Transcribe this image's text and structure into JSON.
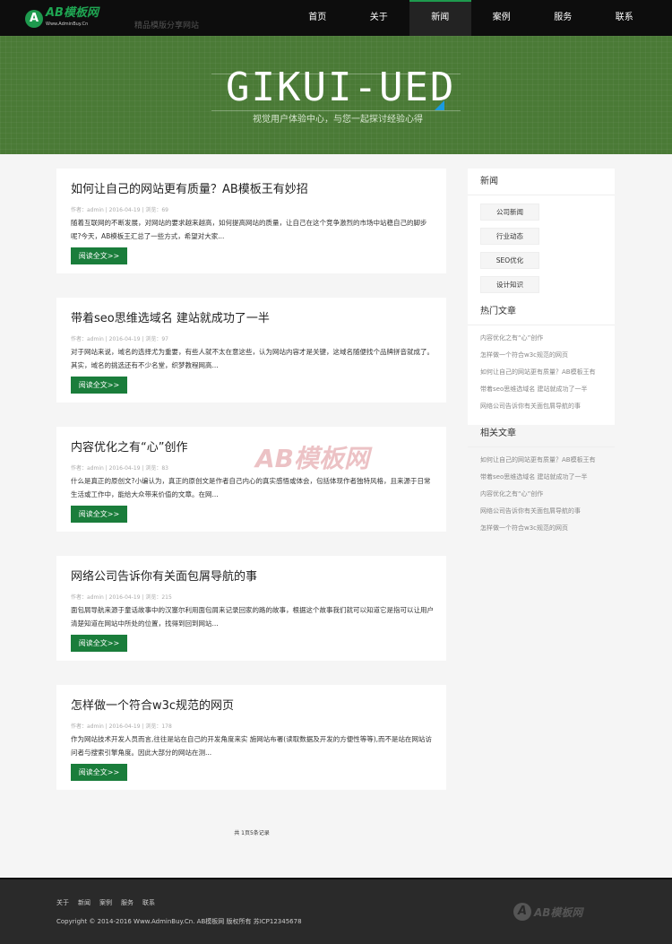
{
  "header": {
    "logo_text": "AB模板网",
    "logo_sub": "Www.AdminBuy.Cn",
    "slogan": "精品模版分享网站",
    "menu": [
      {
        "label": "首页"
      },
      {
        "label": "关于"
      },
      {
        "label": "新闻",
        "active": true
      },
      {
        "label": "案例"
      },
      {
        "label": "服务"
      },
      {
        "label": "联系"
      }
    ]
  },
  "banner": {
    "title": "GIKUI-UED",
    "subtitle": "视觉用户体验中心，与您一起探讨经验心得"
  },
  "posts": [
    {
      "title": "如何让自己的网站更有质量？AB模板王有妙招",
      "meta": "作者：admin | 2016-04-19 | 浏览：69",
      "excerpt": "随着互联网的不断发展，对网站的要求越来越高，如何提高网站的质量，让自己在这个竞争激烈的市场中站稳自己的脚步呢?今天，AB模板王汇总了一些方式，希望对大家...",
      "more": "阅读全文>>"
    },
    {
      "title": "带着seo思维选域名 建站就成功了一半",
      "meta": "作者：admin | 2016-04-19 | 浏览：97",
      "excerpt": "对于网站来说，域名的选择尤为重要，有些人就不太在意这些，认为网站内容才是关键，这域名随便找个品牌拼音就成了。其实，域名的挑选还有不少名堂，织梦教程网高...",
      "more": "阅读全文>>"
    },
    {
      "title": "内容优化之有“心”创作",
      "meta": "作者：admin | 2016-04-19 | 浏览：83",
      "excerpt": "什么是真正的原创文?小编认为，真正的原创文是作者自己内心的真实感悟或体会，包括体现作者独特风格，且来源于日常生活或工作中，能给大众带来价值的文章。在网...",
      "more": "阅读全文>>"
    },
    {
      "title": "网络公司告诉你有关面包屑导航的事",
      "meta": "作者：admin | 2016-04-19 | 浏览：215",
      "excerpt": "面包屑导航来源于童话故事中的汉塞尔利用面包屑来记录回家的路的故事，根据这个故事我们就可以知道它是指可以让用户清楚知道在网站中所处的位置，找得到回到网站...",
      "more": "阅读全文>>"
    },
    {
      "title": "怎样做一个符合w3c规范的网页",
      "meta": "作者：admin | 2016-04-19 | 浏览：178",
      "excerpt": "作为网站技术开发人员而言,往往是站在自己的开发角度来实 施网站布署(读取数据及开发的方便性等等),而不是站在网站访问者与搜索引擎角度。因此大部分的网站在测...",
      "more": "阅读全文>>"
    }
  ],
  "sidebar": {
    "news_title": "新闻",
    "tags": [
      "公司新闻",
      "行业动态",
      "SEO优化",
      "设计知识"
    ],
    "hot_title": "热门文章",
    "hot": [
      "内容优化之有“心”创作",
      "怎样做一个符合w3c规范的网页",
      "如何让自己的网站更有质量？AB模板王有",
      "带着seo思维选域名 建站就成功了一半",
      "网络公司告诉你有关面包屑导航的事"
    ],
    "related_title": "相关文章",
    "related": [
      "如何让自己的网站更有质量？AB模板王有",
      "带着seo思维选域名 建站就成功了一半",
      "内容优化之有“心”创作",
      "网络公司告诉你有关面包屑导航的事",
      "怎样做一个符合w3c规范的网页"
    ]
  },
  "pager": "共 1页5条记录",
  "watermark": "AB模板网",
  "footer": {
    "links": [
      "关于",
      "新闻",
      "案例",
      "服务",
      "联系"
    ],
    "copyright": "Copyright © 2014-2016 Www.AdminBuy.Cn. AB模板网 版权所有 苏ICP12345678",
    "logo_text": "AB模板网"
  }
}
